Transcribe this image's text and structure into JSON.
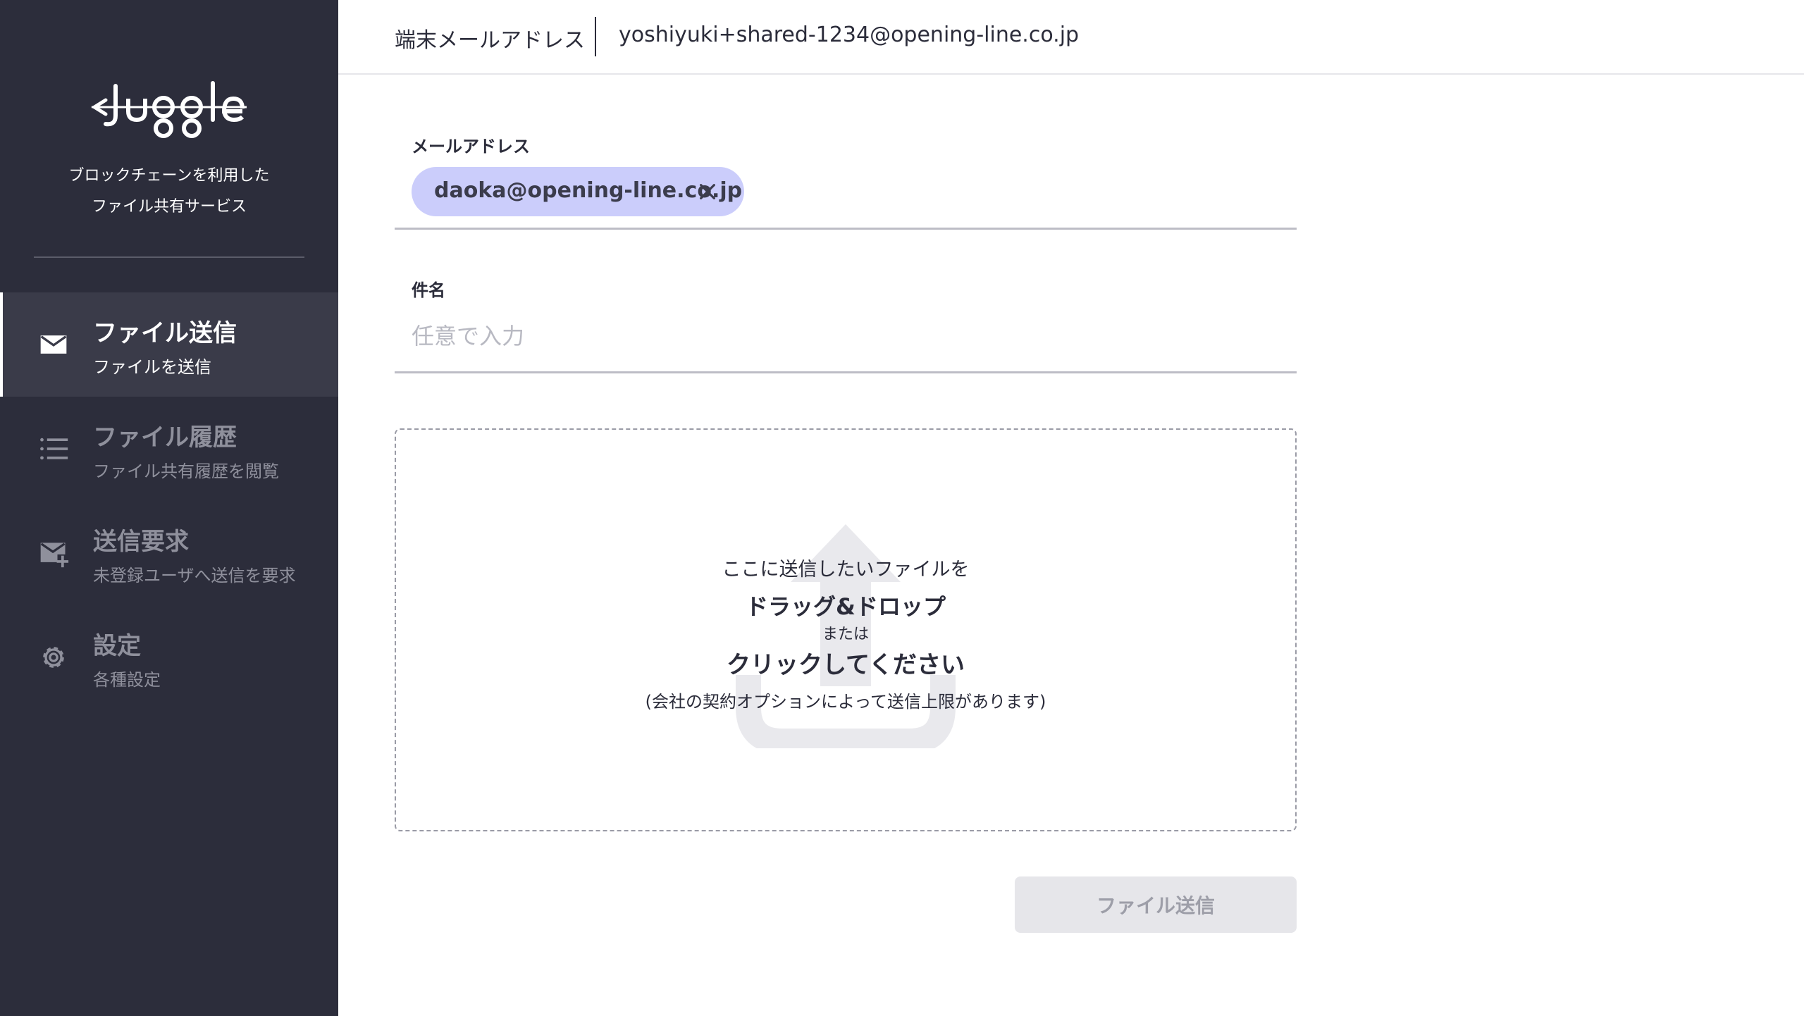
{
  "sidebar": {
    "logo_text": "Juggle",
    "tagline": [
      "ブロックチェーンを利用した",
      "ファイル共有サービス"
    ],
    "items": [
      {
        "title": "ファイル送信",
        "subtitle": "ファイルを送信",
        "icon": "mail-icon",
        "active": true
      },
      {
        "title": "ファイル履歴",
        "subtitle": "ファイル共有履歴を閲覧",
        "icon": "list-icon",
        "active": false
      },
      {
        "title": "送信要求",
        "subtitle": "未登録ユーザへ送信を要求",
        "icon": "mail-add-icon",
        "active": false
      },
      {
        "title": "設定",
        "subtitle": "各種設定",
        "icon": "gear-icon",
        "active": false
      }
    ]
  },
  "header": {
    "label": "端末メールアドレス",
    "value": "yoshiyuki+shared-1234@opening-line.co.jp"
  },
  "form": {
    "email_label": "メールアドレス",
    "recipients": [
      "daoka@opening-line.co.jp"
    ],
    "subject_label": "件名",
    "subject_placeholder": "任意で入力",
    "subject_value": ""
  },
  "dropzone": {
    "line1": "ここに送信したいファイルを",
    "line2": "ドラッグ&ドロップ",
    "line3": "または",
    "line4": "クリックしてください",
    "line5": "(会社の契約オプションによって送信上限があります)"
  },
  "actions": {
    "send_label": "ファイル送信"
  },
  "colors": {
    "sidebar_bg": "#2c2d3b",
    "chip_bg": "#cbcdfb",
    "disabled_button_bg": "#e6e6ea"
  }
}
